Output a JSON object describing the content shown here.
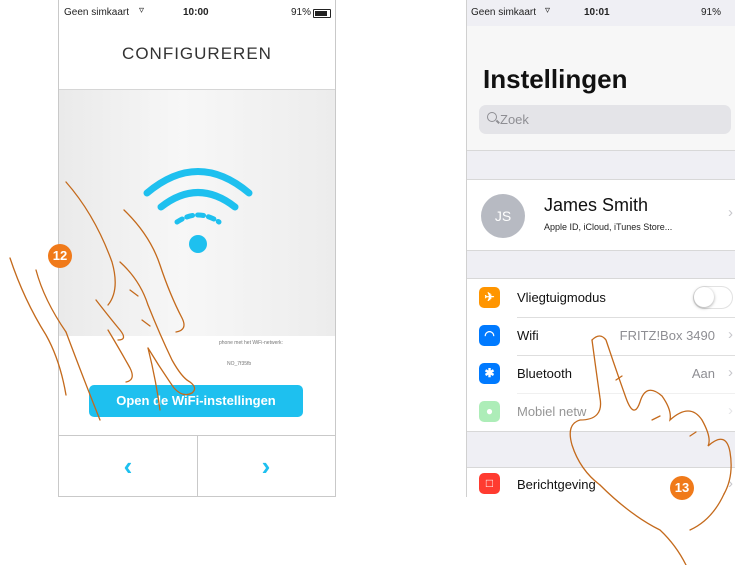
{
  "left_phone": {
    "status": {
      "carrier": "Geen simkaart",
      "time": "10:00",
      "battery": "91%"
    },
    "title": "CONFIGUREREN",
    "instruction_fragment": "phone met het WiFi-netwerk:",
    "network_fragment": "NO_7f35fb",
    "open_button": "Open de WiFi-instellingen",
    "nav_prev": "‹",
    "nav_next": "›",
    "step_badge": "12"
  },
  "right_phone": {
    "status": {
      "carrier": "Geen simkaart",
      "time": "10:01",
      "battery": "91%"
    },
    "title": "Instellingen",
    "search_placeholder": "Zoek",
    "profile": {
      "initials": "JS",
      "name": "James Smith",
      "subtitle": "Apple ID, iCloud, iTunes Store..."
    },
    "rows": [
      {
        "label": "Vliegtuigmodus",
        "value": "",
        "icon": "airplane-icon",
        "color": "#ff9500"
      },
      {
        "label": "Wifi",
        "value": "FRITZ!Box 3490",
        "icon": "wifi-icon",
        "color": "#007aff"
      },
      {
        "label": "Bluetooth",
        "value": "Aan",
        "icon": "bluetooth-icon",
        "color": "#007aff"
      },
      {
        "label": "Mobiel netw",
        "value": "",
        "icon": "antenna-icon",
        "color": "#4cd964"
      }
    ],
    "notifications_label": "Berichtgeving",
    "step_badge": "13"
  }
}
